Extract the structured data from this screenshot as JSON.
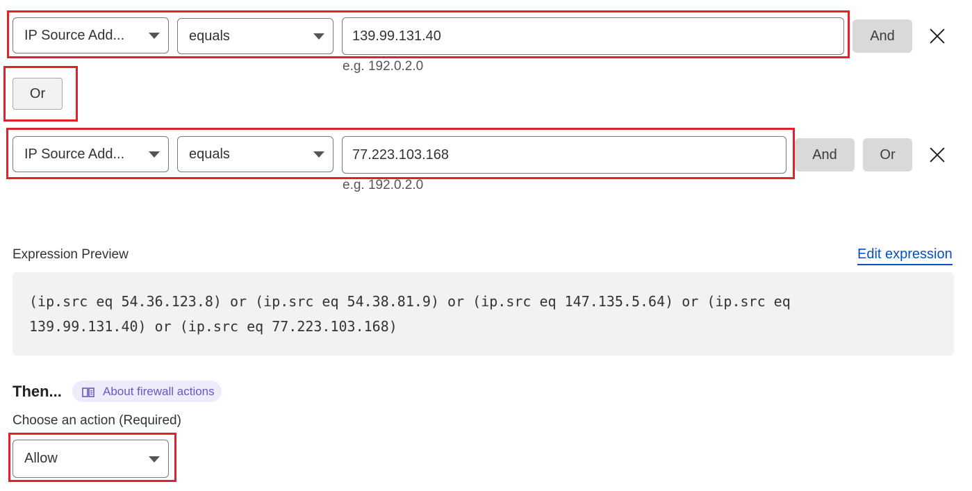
{
  "rows": [
    {
      "field": "IP Source Add...",
      "operator": "equals",
      "value": "139.99.131.40",
      "hint": "e.g. 192.0.2.0",
      "buttons": [
        "And"
      ]
    },
    {
      "field": "IP Source Add...",
      "operator": "equals",
      "value": "77.223.103.168",
      "hint": "e.g. 192.0.2.0",
      "buttons": [
        "And",
        "Or"
      ]
    }
  ],
  "or_button_label": "Or",
  "expression_preview": {
    "label": "Expression Preview",
    "edit_link": "Edit expression",
    "text": "(ip.src eq 54.36.123.8) or (ip.src eq 54.38.81.9) or (ip.src eq 147.135.5.64) or (ip.src eq\n139.99.131.40) or (ip.src eq 77.223.103.168)"
  },
  "then": {
    "heading": "Then...",
    "help_link": "About firewall actions",
    "action_label": "Choose an action (Required)",
    "action_value": "Allow"
  },
  "colors": {
    "highlight": "#e3202b",
    "link": "#0051c3",
    "pill_bg": "#eeecfb",
    "pill_text": "#6658c8"
  }
}
